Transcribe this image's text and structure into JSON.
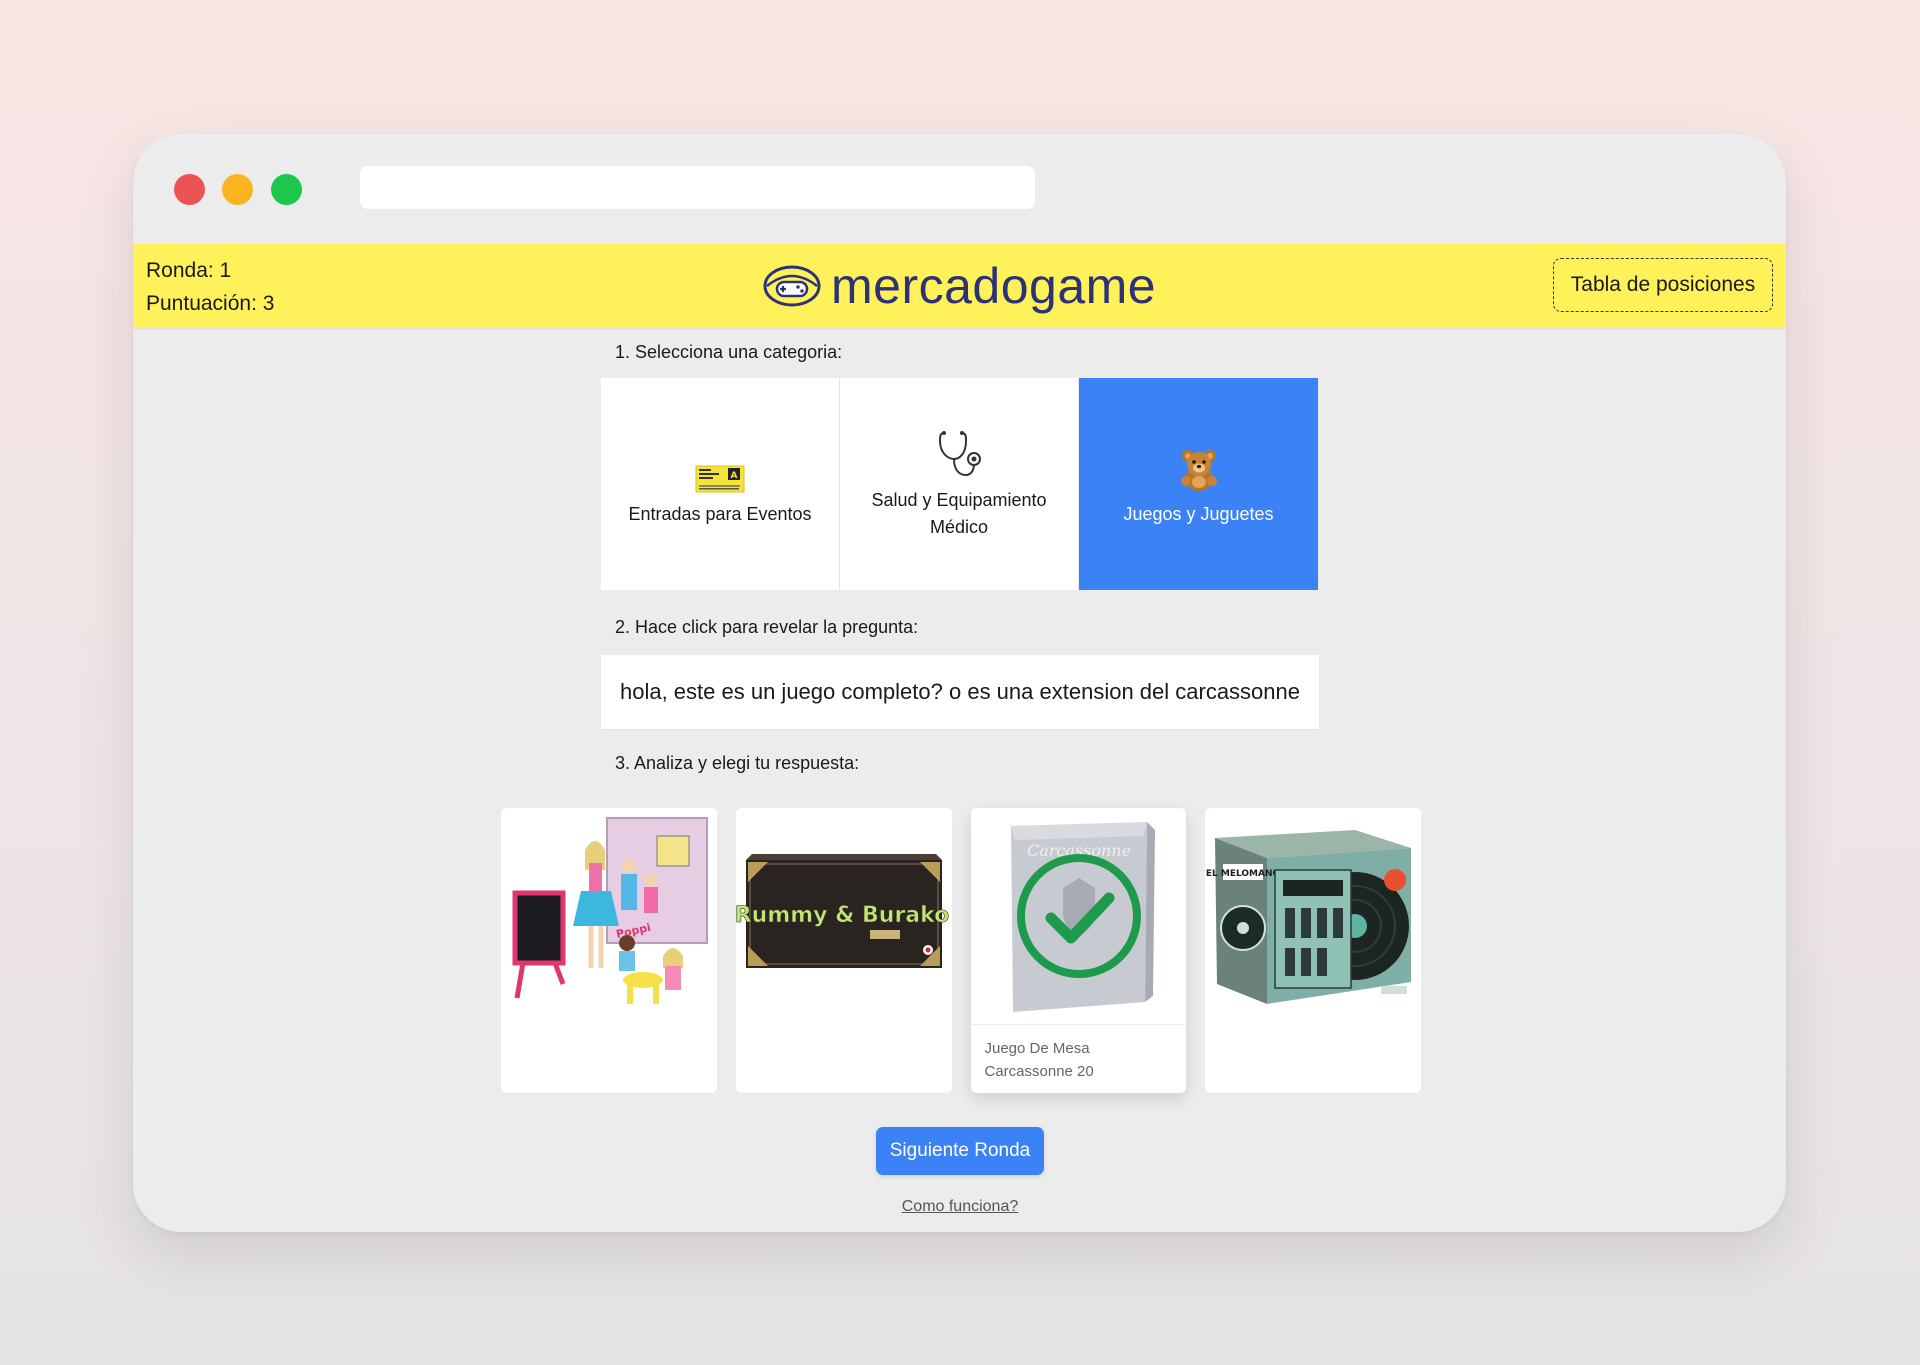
{
  "header": {
    "round_text": "Ronda: 1",
    "score_text": "Puntuación: 3",
    "logo_text": "mercadogame",
    "leaderboard_label": "Tabla de posiciones",
    "accent_color": "#fff159",
    "logo_color": "#2d3277"
  },
  "steps": {
    "step1": "1. Selecciona una categoria:",
    "step2": "2. Hace click para revelar la pregunta:",
    "step3": "3. Analiza y elegi tu respuesta:"
  },
  "categories": [
    {
      "label": "Entradas para Eventos",
      "icon": "ticket-icon",
      "selected": false
    },
    {
      "label": "Salud y Equipamiento Médico",
      "icon": "stethoscope-icon",
      "selected": false
    },
    {
      "label": "Juegos y Juguetes",
      "icon": "teddy-bear-icon",
      "selected": true
    }
  ],
  "question": {
    "text": "hola, este es un juego completo? o es una extension del carcassonne"
  },
  "answers": [
    {
      "image": "dolls-playset-image",
      "caption": "",
      "selected": false
    },
    {
      "image": "rummy-burako-box-image",
      "caption": "",
      "selected": false,
      "box_text": "Rummy & Burako"
    },
    {
      "image": "carcassonne-box-image",
      "caption": "Juego De Mesa Carcassonne 20",
      "selected": true,
      "correct": true
    },
    {
      "image": "el-melomano-box-image",
      "caption": "",
      "selected": false,
      "box_text": "EL MELOMANO"
    }
  ],
  "footer": {
    "next_button": "Siguiente Ronda",
    "how_link": "Como funciona?",
    "button_color": "#3a82f5"
  }
}
